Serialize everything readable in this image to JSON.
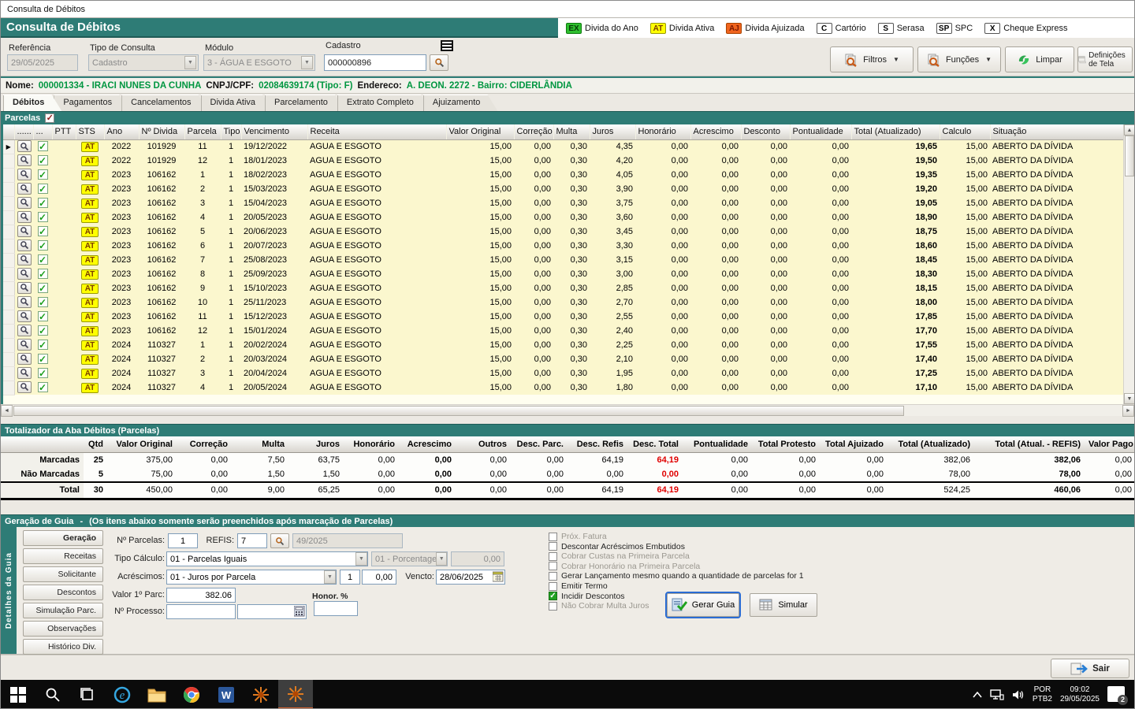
{
  "window": {
    "title": "Consulta de Débitos"
  },
  "header": {
    "title": "Consulta de Débitos"
  },
  "legend": {
    "items": [
      {
        "code": "EX",
        "label": "Divida do Ano",
        "bg": "#2FBF2F",
        "fg": "#063806",
        "border": "#0D7A0D"
      },
      {
        "code": "AT",
        "label": "Divida Ativa",
        "bg": "#FFFF00",
        "fg": "#7A3B00",
        "border": "#9A9A00"
      },
      {
        "code": "AJ",
        "label": "Divida Ajuizada",
        "bg": "#F0641E",
        "fg": "#7A1800",
        "border": "#A84300"
      },
      {
        "code": "C",
        "label": "Cartório",
        "bg": "#FFFFFF",
        "fg": "#000000",
        "border": "#555555"
      },
      {
        "code": "S",
        "label": "Serasa",
        "bg": "#FFFFFF",
        "fg": "#000000",
        "border": "#555555"
      },
      {
        "code": "SP",
        "label": "SPC",
        "bg": "#FFFFFF",
        "fg": "#000000",
        "border": "#555555"
      },
      {
        "code": "X",
        "label": "Cheque Express",
        "bg": "#FFFFFF",
        "fg": "#000000",
        "border": "#555555"
      }
    ]
  },
  "filters": {
    "referencia": {
      "label": "Referência",
      "value": "29/05/2025"
    },
    "tipo_consulta": {
      "label": "Tipo de Consulta",
      "value": "Cadastro"
    },
    "modulo": {
      "label": "Módulo",
      "value": "3 - ÁGUA E ESGOTO"
    },
    "cadastro": {
      "label": "Cadastro",
      "value": "000000896"
    }
  },
  "toolbar": {
    "filtros": "Filtros",
    "funcoes": "Funções",
    "limpar": "Limpar",
    "definicoes": "Definições de Tela"
  },
  "customer": {
    "nome_label": "Nome:",
    "nome": "000001334 - IRACI NUNES DA CUNHA",
    "cnpj_label": "CNPJ/CPF:",
    "cnpj": "02084639174 (Tipo: F)",
    "endereco_label": "Endereco:",
    "endereco": "A. DEON. 2272 - Bairro: CIDERLÂNDIA"
  },
  "tabs": {
    "items": [
      {
        "label": "Débitos",
        "active": true
      },
      {
        "label": "Pagamentos",
        "active": false
      },
      {
        "label": "Cancelamentos",
        "active": false
      },
      {
        "label": "Divida Ativa",
        "active": false
      },
      {
        "label": "Parcelamento",
        "active": false
      },
      {
        "label": "Extrato Completo",
        "active": false
      },
      {
        "label": "Ajuizamento",
        "active": false
      }
    ]
  },
  "parcelas_bar": {
    "label": "Parcelas",
    "checked": true
  },
  "grid": {
    "headers": [
      "......",
      "...",
      "PTT",
      "STS",
      "Ano",
      "Nº Divida",
      "Parcela",
      "Tipo",
      "Vencimento",
      "Receita",
      "Valor Original",
      "Correção",
      "Multa",
      "Juros",
      "Honorário",
      "Acrescimo",
      "Desconto",
      "Pontualidade",
      "Total (Atualizado)",
      "Calculo",
      "Situação"
    ],
    "row_fields": [
      "sts",
      "ano",
      "n_divida",
      "parcela",
      "tipo",
      "vencimento",
      "receita",
      "valor_original",
      "correcao",
      "multa",
      "juros",
      "honorario",
      "acrescimo",
      "desconto",
      "pontualidade",
      "total_atualizado",
      "calculo",
      "situacao"
    ],
    "rows": [
      [
        "AT",
        "2022",
        "101929",
        "11",
        "1",
        "19/12/2022",
        "AGUA E ESGOTO",
        "15,00",
        "0,00",
        "0,30",
        "4,35",
        "0,00",
        "0,00",
        "0,00",
        "0,00",
        "19,65",
        "15,00",
        "ABERTO DA DÍVIDA"
      ],
      [
        "AT",
        "2022",
        "101929",
        "12",
        "1",
        "18/01/2023",
        "AGUA E ESGOTO",
        "15,00",
        "0,00",
        "0,30",
        "4,20",
        "0,00",
        "0,00",
        "0,00",
        "0,00",
        "19,50",
        "15,00",
        "ABERTO DA DÍVIDA"
      ],
      [
        "AT",
        "2023",
        "106162",
        "1",
        "1",
        "18/02/2023",
        "AGUA E ESGOTO",
        "15,00",
        "0,00",
        "0,30",
        "4,05",
        "0,00",
        "0,00",
        "0,00",
        "0,00",
        "19,35",
        "15,00",
        "ABERTO DA DÍVIDA"
      ],
      [
        "AT",
        "2023",
        "106162",
        "2",
        "1",
        "15/03/2023",
        "AGUA E ESGOTO",
        "15,00",
        "0,00",
        "0,30",
        "3,90",
        "0,00",
        "0,00",
        "0,00",
        "0,00",
        "19,20",
        "15,00",
        "ABERTO DA DÍVIDA"
      ],
      [
        "AT",
        "2023",
        "106162",
        "3",
        "1",
        "15/04/2023",
        "AGUA E ESGOTO",
        "15,00",
        "0,00",
        "0,30",
        "3,75",
        "0,00",
        "0,00",
        "0,00",
        "0,00",
        "19,05",
        "15,00",
        "ABERTO DA DÍVIDA"
      ],
      [
        "AT",
        "2023",
        "106162",
        "4",
        "1",
        "20/05/2023",
        "AGUA E ESGOTO",
        "15,00",
        "0,00",
        "0,30",
        "3,60",
        "0,00",
        "0,00",
        "0,00",
        "0,00",
        "18,90",
        "15,00",
        "ABERTO DA DÍVIDA"
      ],
      [
        "AT",
        "2023",
        "106162",
        "5",
        "1",
        "20/06/2023",
        "AGUA E ESGOTO",
        "15,00",
        "0,00",
        "0,30",
        "3,45",
        "0,00",
        "0,00",
        "0,00",
        "0,00",
        "18,75",
        "15,00",
        "ABERTO DA DÍVIDA"
      ],
      [
        "AT",
        "2023",
        "106162",
        "6",
        "1",
        "20/07/2023",
        "AGUA E ESGOTO",
        "15,00",
        "0,00",
        "0,30",
        "3,30",
        "0,00",
        "0,00",
        "0,00",
        "0,00",
        "18,60",
        "15,00",
        "ABERTO DA DÍVIDA"
      ],
      [
        "AT",
        "2023",
        "106162",
        "7",
        "1",
        "25/08/2023",
        "AGUA E ESGOTO",
        "15,00",
        "0,00",
        "0,30",
        "3,15",
        "0,00",
        "0,00",
        "0,00",
        "0,00",
        "18,45",
        "15,00",
        "ABERTO DA DÍVIDA"
      ],
      [
        "AT",
        "2023",
        "106162",
        "8",
        "1",
        "25/09/2023",
        "AGUA E ESGOTO",
        "15,00",
        "0,00",
        "0,30",
        "3,00",
        "0,00",
        "0,00",
        "0,00",
        "0,00",
        "18,30",
        "15,00",
        "ABERTO DA DÍVIDA"
      ],
      [
        "AT",
        "2023",
        "106162",
        "9",
        "1",
        "15/10/2023",
        "AGUA E ESGOTO",
        "15,00",
        "0,00",
        "0,30",
        "2,85",
        "0,00",
        "0,00",
        "0,00",
        "0,00",
        "18,15",
        "15,00",
        "ABERTO DA DÍVIDA"
      ],
      [
        "AT",
        "2023",
        "106162",
        "10",
        "1",
        "25/11/2023",
        "AGUA E ESGOTO",
        "15,00",
        "0,00",
        "0,30",
        "2,70",
        "0,00",
        "0,00",
        "0,00",
        "0,00",
        "18,00",
        "15,00",
        "ABERTO DA DÍVIDA"
      ],
      [
        "AT",
        "2023",
        "106162",
        "11",
        "1",
        "15/12/2023",
        "AGUA E ESGOTO",
        "15,00",
        "0,00",
        "0,30",
        "2,55",
        "0,00",
        "0,00",
        "0,00",
        "0,00",
        "17,85",
        "15,00",
        "ABERTO DA DÍVIDA"
      ],
      [
        "AT",
        "2023",
        "106162",
        "12",
        "1",
        "15/01/2024",
        "AGUA E ESGOTO",
        "15,00",
        "0,00",
        "0,30",
        "2,40",
        "0,00",
        "0,00",
        "0,00",
        "0,00",
        "17,70",
        "15,00",
        "ABERTO DA DÍVIDA"
      ],
      [
        "AT",
        "2024",
        "110327",
        "1",
        "1",
        "20/02/2024",
        "AGUA E ESGOTO",
        "15,00",
        "0,00",
        "0,30",
        "2,25",
        "0,00",
        "0,00",
        "0,00",
        "0,00",
        "17,55",
        "15,00",
        "ABERTO DA DÍVIDA"
      ],
      [
        "AT",
        "2024",
        "110327",
        "2",
        "1",
        "20/03/2024",
        "AGUA E ESGOTO",
        "15,00",
        "0,00",
        "0,30",
        "2,10",
        "0,00",
        "0,00",
        "0,00",
        "0,00",
        "17,40",
        "15,00",
        "ABERTO DA DÍVIDA"
      ],
      [
        "AT",
        "2024",
        "110327",
        "3",
        "1",
        "20/04/2024",
        "AGUA E ESGOTO",
        "15,00",
        "0,00",
        "0,30",
        "1,95",
        "0,00",
        "0,00",
        "0,00",
        "0,00",
        "17,25",
        "15,00",
        "ABERTO DA DÍVIDA"
      ],
      [
        "AT",
        "2024",
        "110327",
        "4",
        "1",
        "20/05/2024",
        "AGUA E ESGOTO",
        "15,00",
        "0,00",
        "0,30",
        "1,80",
        "0,00",
        "0,00",
        "0,00",
        "0,00",
        "17,10",
        "15,00",
        "ABERTO DA DÍVIDA"
      ]
    ]
  },
  "totalizador": {
    "title": "Totalizador da Aba Débitos (Parcelas)",
    "headers": [
      "Qtd",
      "Valor Original",
      "Correção",
      "Multa",
      "Juros",
      "Honorário",
      "Acrescimo",
      "Outros",
      "Desc. Parc.",
      "Desc. Refis",
      "Desc. Total",
      "Pontualidade",
      "Total Protesto",
      "Total Ajuizado",
      "Total (Atualizado)",
      "Total (Atual. - REFIS)",
      "Valor Pago"
    ],
    "rows": [
      {
        "label": "Marcadas",
        "values": [
          "25",
          "375,00",
          "0,00",
          "7,50",
          "63,75",
          "0,00",
          "0,00",
          "0,00",
          "0,00",
          "64,19",
          "64,19",
          "0,00",
          "0,00",
          "0,00",
          "382,06",
          "382,06",
          "0,00"
        ]
      },
      {
        "label": "Não Marcadas",
        "values": [
          "5",
          "75,00",
          "0,00",
          "1,50",
          "1,50",
          "0,00",
          "0,00",
          "0,00",
          "0,00",
          "0,00",
          "0,00",
          "0,00",
          "0,00",
          "0,00",
          "78,00",
          "78,00",
          "0,00"
        ]
      },
      {
        "label": "Total",
        "values": [
          "30",
          "450,00",
          "0,00",
          "9,00",
          "65,25",
          "0,00",
          "0,00",
          "0,00",
          "0,00",
          "64,19",
          "64,19",
          "0,00",
          "0,00",
          "0,00",
          "524,25",
          "460,06",
          "0,00"
        ],
        "is_total": true
      }
    ]
  },
  "guia": {
    "title": "Geração de Guia",
    "sep": "-",
    "subtitle": "(Os itens abaixo somente serão preenchidos após marcação de Parcelas)",
    "strip": "Detalhes da Guia",
    "buttons": [
      {
        "label": "Geração",
        "active": true
      },
      {
        "label": "Receitas",
        "active": false
      },
      {
        "label": "Solicitante",
        "active": false
      },
      {
        "label": "Descontos",
        "active": false
      },
      {
        "label": "Simulação Parc.",
        "active": false
      },
      {
        "label": "Observações",
        "active": false
      },
      {
        "label": "Histórico Div.",
        "active": false
      }
    ],
    "fields": {
      "n_parcelas_label": "Nº Parcelas:",
      "n_parcelas": "1",
      "refis_label": "REFIS:",
      "refis": "7",
      "refis_num": "49/2025",
      "tipo_calculo_label": "Tipo Cálculo:",
      "tipo_calculo": "01 - Parcelas Iguais",
      "porcentagem": "01 - Porcentagem",
      "porcentagem_valor": "0,00",
      "acrescimos_label": "Acréscimos:",
      "acrescimos": "01 - Juros por Parcela",
      "acrescimos_n": "1",
      "acrescimos_valor": "0,00",
      "vencto_label": "Vencto:",
      "vencto": "28/06/2025",
      "valor_parc_label": "Valor 1º Parc:",
      "valor_parc": "382.06",
      "honor_label": "Honor. %",
      "honor": "",
      "processo_label": "Nº Processo:",
      "processo": "",
      "processo2": ""
    },
    "checkboxes": [
      {
        "label": "Próx. Fatura",
        "checked": false,
        "enabled": false
      },
      {
        "label": "Descontar Acréscimos Embutidos",
        "checked": false,
        "enabled": true
      },
      {
        "label": "Cobrar Custas na Primeira Parcela",
        "checked": false,
        "enabled": false
      },
      {
        "label": "Cobrar Honorário na Primeira Parcela",
        "checked": false,
        "enabled": false
      },
      {
        "label": "Gerar Lançamento mesmo quando a quantidade de parcelas for 1",
        "checked": false,
        "enabled": true
      },
      {
        "label": "Emitir Termo",
        "checked": false,
        "enabled": true
      },
      {
        "label": "Incidir Descontos",
        "checked": true,
        "enabled": true
      },
      {
        "label": "Não Cobrar Multa Juros",
        "checked": false,
        "enabled": false
      }
    ],
    "gerar_guia": "Gerar Guia",
    "simular": "Simular"
  },
  "bottom": {
    "sair": "Sair"
  },
  "taskbar": {
    "icons": [
      "start",
      "search",
      "task-view",
      "internet-explorer",
      "file-explorer",
      "chrome",
      "word",
      "app-sistema",
      "app-sistema-active"
    ],
    "lang_top": "POR",
    "lang_bottom": "PTB2",
    "time": "09:02",
    "date": "29/05/2025",
    "notification_count": "2"
  },
  "colors": {
    "teal": "#2E7C76",
    "row_bg": "#FBF7CE",
    "vencimento_bg": "#F1B2B8",
    "at_badge_bg": "#FFFF00",
    "at_badge_text": "#7A3B00",
    "green_text": "#009640",
    "red_text": "#E00000"
  }
}
